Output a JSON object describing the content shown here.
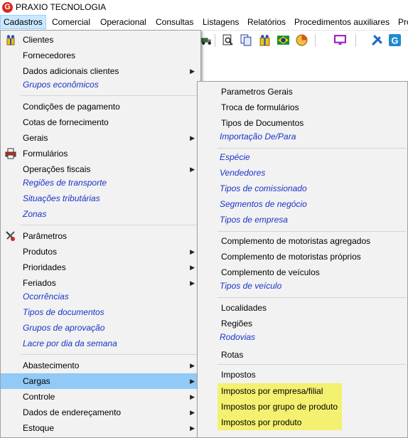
{
  "app": {
    "title": "PRAXIO TECNOLOGIA",
    "logo_letter": "G",
    "brand_color": "#d9261c"
  },
  "menubar": [
    {
      "label": "Cadastros",
      "active": true
    },
    {
      "label": "Comercial"
    },
    {
      "label": "Operacional"
    },
    {
      "label": "Consultas"
    },
    {
      "label": "Listagens"
    },
    {
      "label": "Relatórios"
    },
    {
      "label": "Procedimentos auxiliares"
    },
    {
      "label": "Pro"
    }
  ],
  "toolbar_icons": [
    "truck-icon",
    "print-preview-icon",
    "copy-documents-icon",
    "users-gift-icon",
    "brazil-flag-icon",
    "pie-chart-icon",
    "monitor-icon",
    "tools-icon",
    "g-logo-icon"
  ],
  "main_menu": {
    "items": [
      {
        "label": "Clientes",
        "icon": "clients-icon"
      },
      {
        "label": "Fornecedores"
      },
      {
        "label": "Dados adicionais clientes",
        "arrow": true
      },
      {
        "label": "Grupos econômicos",
        "link": true
      },
      {
        "label": "Condições de pagamento"
      },
      {
        "label": "Cotas de fornecimento"
      },
      {
        "label": "Gerais",
        "arrow": true
      },
      {
        "label": "Formulários",
        "icon": "printer-icon"
      },
      {
        "label": "Operações fiscais",
        "arrow": true
      },
      {
        "label": "Regiões de transporte",
        "link": true
      },
      {
        "label": "Situações tributárias",
        "link": true
      },
      {
        "label": "Zonas",
        "link": true
      },
      {
        "label": "Parâmetros",
        "icon": "parameters-icon"
      },
      {
        "label": "Produtos",
        "arrow": true
      },
      {
        "label": "Prioridades",
        "arrow": true
      },
      {
        "label": "Feriados",
        "arrow": true
      },
      {
        "label": "Ocorrências",
        "link": true
      },
      {
        "label": "Tipos de documentos",
        "link": true
      },
      {
        "label": "Grupos de aprovação",
        "link": true
      },
      {
        "label": "Lacre por dia da semana",
        "link": true
      },
      {
        "label": "Abastecimento",
        "arrow": true
      },
      {
        "label": "Cargas",
        "arrow": true,
        "highlighted": true
      },
      {
        "label": "Controle",
        "arrow": true
      },
      {
        "label": "Dados de endereçamento",
        "arrow": true
      },
      {
        "label": "Estoque",
        "arrow": true
      }
    ]
  },
  "sub_menu": {
    "items": [
      {
        "label": "Parametros Gerais"
      },
      {
        "label": "Troca de formulários"
      },
      {
        "label": "Tipos de Documentos"
      },
      {
        "label": "Importação De/Para",
        "link": true
      },
      {
        "label": "Espécie",
        "link": true
      },
      {
        "label": "Vendedores",
        "link": true
      },
      {
        "label": "Tipos de  comissionado",
        "link": true
      },
      {
        "label": "Segmentos de negócio",
        "link": true
      },
      {
        "label": "Tipos de empresa",
        "link": true
      },
      {
        "label": "Complemento de motoristas agregados"
      },
      {
        "label": "Complemento de motoristas próprios"
      },
      {
        "label": "Complemento de veículos"
      },
      {
        "label": "Tipos de veículo",
        "link": true
      },
      {
        "label": "Localidades"
      },
      {
        "label": "Regiões"
      },
      {
        "label": "Rodovias",
        "link": true
      },
      {
        "label": "Rotas"
      },
      {
        "label": "Impostos"
      },
      {
        "label": "Impostos por empresa/filial",
        "highlighted": true
      },
      {
        "label": "Impostos por grupo de produto",
        "highlighted": true
      },
      {
        "label": "Impostos por produto",
        "highlighted": true
      }
    ]
  },
  "colors": {
    "link": "#1a33c8",
    "selection": "#91c9f7",
    "annotation_highlight": "#f3f16f",
    "menu_bg": "#f2f2f2"
  }
}
